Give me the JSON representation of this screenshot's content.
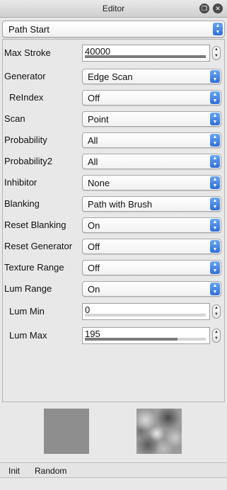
{
  "window": {
    "title": "Editor"
  },
  "top_select": {
    "value": "Path Start"
  },
  "rows": [
    {
      "label": "Max Stroke",
      "value": "40000",
      "level": 1.0
    },
    {
      "label": "Generator",
      "value": "Edge Scan"
    },
    {
      "label": "ReIndex",
      "value": "Off"
    },
    {
      "label": "Scan",
      "value": "Point"
    },
    {
      "label": "Probability",
      "value": "All"
    },
    {
      "label": "Probability2",
      "value": "All"
    },
    {
      "label": "Inhibitor",
      "value": "None"
    },
    {
      "label": "Blanking",
      "value": "Path with Brush"
    },
    {
      "label": "Reset Blanking",
      "value": "On"
    },
    {
      "label": "Reset Generator",
      "value": "Off"
    },
    {
      "label": "Texture Range",
      "value": "Off"
    },
    {
      "label": "Lum Range",
      "value": "On"
    },
    {
      "label": "Lum Min",
      "value": "0",
      "level": 0.0
    },
    {
      "label": "Lum Max",
      "value": "195",
      "level": 0.765
    }
  ],
  "bottom": {
    "init_label": "Init",
    "random_label": "Random"
  },
  "icons": {
    "detach": "detach-icon",
    "close": "close-icon",
    "dropdown": "updown-arrows-icon",
    "stepper": "stepper-icon"
  }
}
